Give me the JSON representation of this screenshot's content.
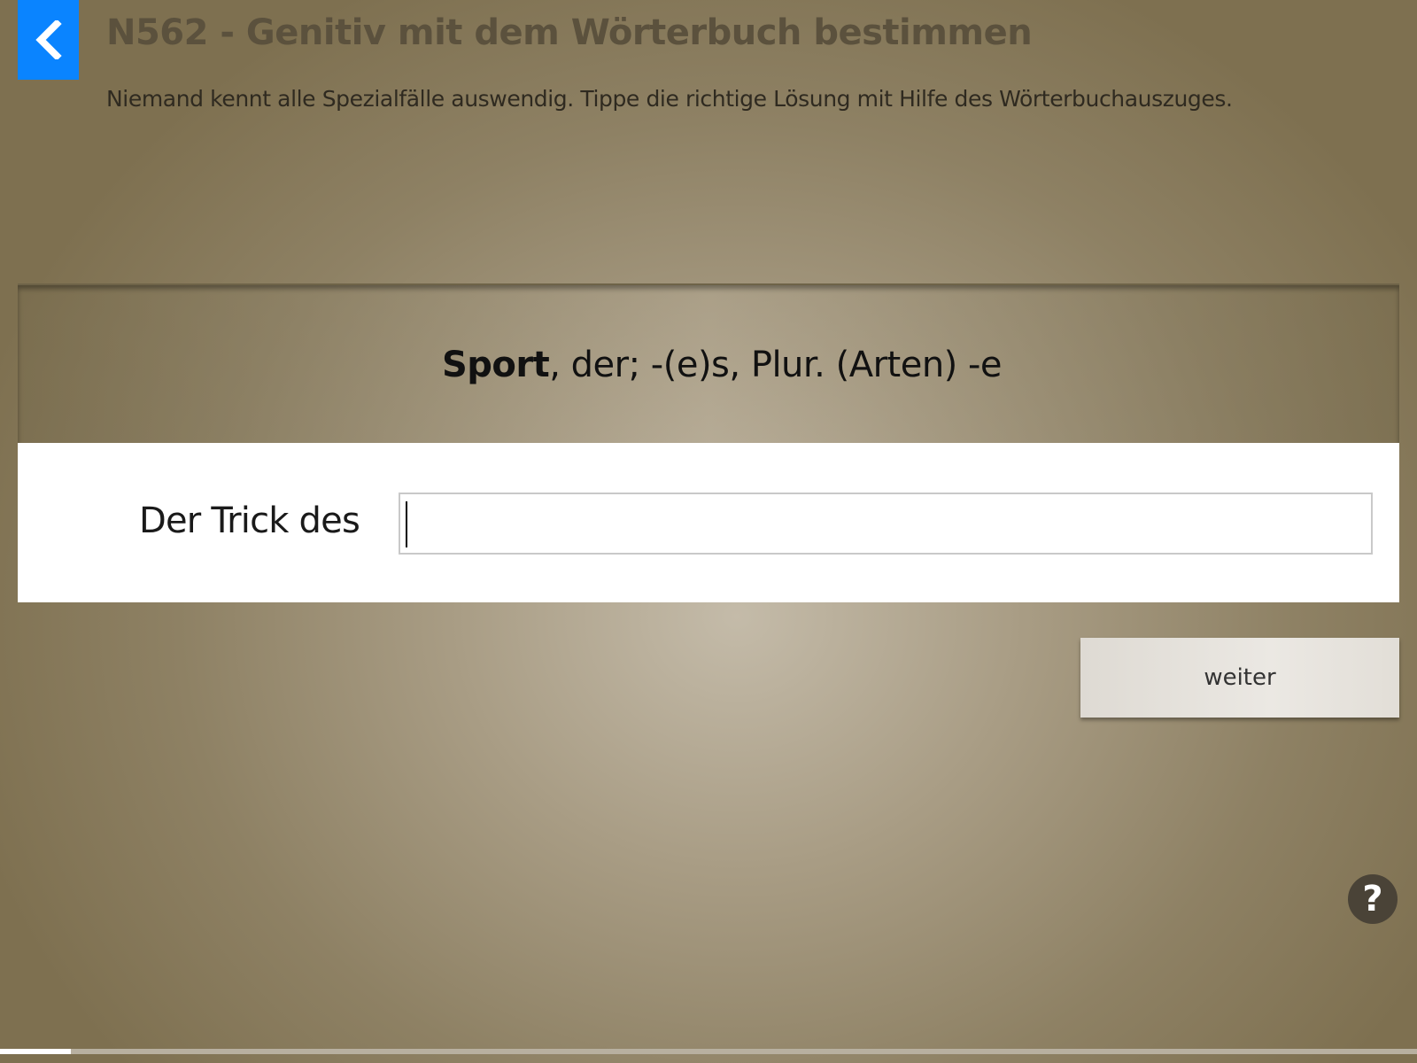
{
  "header": {
    "title": "N562 - Genitiv mit dem Wörterbuch bestimmen",
    "instruction": "Niemand kennt alle Spezialfälle auswendig. Tippe die richtige Lösung mit Hilfe des Wörterbuchauszuges.",
    "back_icon": "chevron-left-icon",
    "accent_color": "#0a84ff"
  },
  "dictionary": {
    "headword": "Sport",
    "definition": ", der; -(e)s, Plur. (Arten) -e"
  },
  "exercise": {
    "label": "Der Trick des",
    "input_value": "",
    "input_placeholder": ""
  },
  "actions": {
    "next_label": "weiter",
    "help_label": "?"
  },
  "progress": {
    "fraction": 0.05
  }
}
